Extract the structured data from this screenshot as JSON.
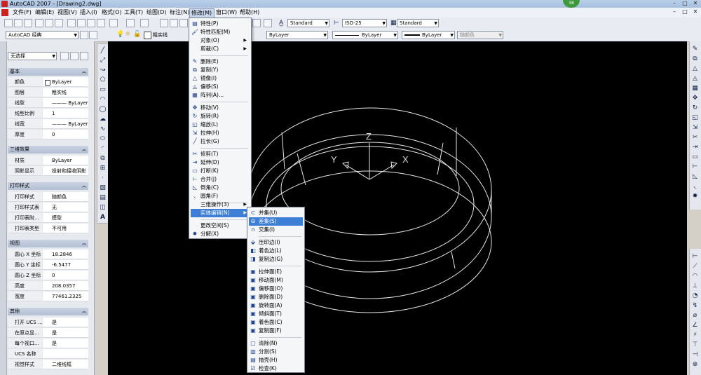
{
  "window": {
    "title": "AutoCAD 2007 - [Drawing2.dwg]",
    "badge": "38",
    "controls": [
      "–",
      "□",
      "✕"
    ]
  },
  "menubar": {
    "items": [
      {
        "label": "文件(F)"
      },
      {
        "label": "编辑(E)"
      },
      {
        "label": "视图(V)"
      },
      {
        "label": "插入(I)"
      },
      {
        "label": "格式(O)"
      },
      {
        "label": "工具(T)"
      },
      {
        "label": "绘图(D)"
      },
      {
        "label": "标注(N)"
      },
      {
        "label": "修改(M)",
        "active": true
      },
      {
        "label": "窗口(W)"
      },
      {
        "label": "帮助(H)"
      }
    ],
    "doc_controls": [
      "–",
      "□",
      "✕"
    ]
  },
  "toolbar1": {
    "text_style": "Standard",
    "dim_style": "ISO-25",
    "table_style": "Standard"
  },
  "toolbar2": {
    "workspace": "AutoCAD 经典",
    "layer": "粗实线",
    "color": "ByLayer",
    "linetype": "ByLayer",
    "lineweight": "ByLayer",
    "plotstyle": "随颜色"
  },
  "properties": {
    "selection": "无选择",
    "sections": [
      {
        "title": "基本",
        "rows": [
          {
            "label": "颜色",
            "value": "ByLayer"
          },
          {
            "label": "图层",
            "value": "粗实线"
          },
          {
            "label": "线型",
            "value": "——— ByLayer"
          },
          {
            "label": "线型比例",
            "value": "1"
          },
          {
            "label": "线宽",
            "value": "——— ByLayer"
          },
          {
            "label": "厚度",
            "value": "0"
          }
        ]
      },
      {
        "title": "三维效果",
        "rows": [
          {
            "label": "材质",
            "value": "ByLayer"
          },
          {
            "label": "阴影显示",
            "value": "投射和接收阴影"
          }
        ]
      },
      {
        "title": "打印样式",
        "rows": [
          {
            "label": "打印样式",
            "value": "随颜色"
          },
          {
            "label": "打印样式表",
            "value": "无"
          },
          {
            "label": "打印表附...",
            "value": "模型"
          },
          {
            "label": "打印表类型",
            "value": "不可用"
          }
        ]
      },
      {
        "title": "视图",
        "rows": [
          {
            "label": "圆心 X 坐标",
            "value": "18.2846"
          },
          {
            "label": "圆心 Y 坐标",
            "value": "-6.5477"
          },
          {
            "label": "圆心 Z 坐标",
            "value": "0"
          },
          {
            "label": "高度",
            "value": "208.0357"
          },
          {
            "label": "宽度",
            "value": "77461.2325"
          }
        ]
      },
      {
        "title": "其他",
        "rows": [
          {
            "label": "打开 UCS ...",
            "value": "是"
          },
          {
            "label": "在原点显...",
            "value": "是"
          },
          {
            "label": "每个视口...",
            "value": "是"
          },
          {
            "label": "UCS 名称",
            "value": ""
          },
          {
            "label": "视觉样式",
            "value": "二维线框"
          }
        ]
      }
    ]
  },
  "modify_menu": {
    "items": [
      {
        "label": "特性(P)",
        "icon": "properties-icon"
      },
      {
        "label": "特性匹配(M)",
        "icon": "match-brush-icon"
      },
      {
        "label": "对象(O)",
        "icon": "",
        "submenu": true
      },
      {
        "label": "剪裁(C)",
        "icon": "",
        "submenu": true
      },
      {
        "label": "删除(E)",
        "icon": "eraser-icon"
      },
      {
        "label": "复制(Y)",
        "icon": "copy-icon"
      },
      {
        "label": "镜像(I)",
        "icon": "mirror-icon"
      },
      {
        "label": "偏移(S)",
        "icon": "offset-icon"
      },
      {
        "label": "阵列(A)...",
        "icon": "array-icon"
      },
      {
        "label": "移动(V)",
        "icon": "move-icon"
      },
      {
        "label": "旋转(R)",
        "icon": "rotate-icon"
      },
      {
        "label": "缩放(L)",
        "icon": "scale-icon"
      },
      {
        "label": "拉伸(H)",
        "icon": "stretch-icon"
      },
      {
        "label": "拉长(G)",
        "icon": "lengthen-icon"
      },
      {
        "label": "修剪(T)",
        "icon": "trim-icon"
      },
      {
        "label": "延伸(D)",
        "icon": "extend-icon"
      },
      {
        "label": "打断(K)",
        "icon": "break-icon"
      },
      {
        "label": "合并(J)",
        "icon": "join-icon"
      },
      {
        "label": "倒角(C)",
        "icon": "chamfer-icon"
      },
      {
        "label": "圆角(F)",
        "icon": "fillet-icon"
      },
      {
        "label": "三维操作(3)",
        "icon": "",
        "submenu": true
      },
      {
        "label": "实体编辑(N)",
        "icon": "",
        "submenu": true,
        "highlight": true
      },
      {
        "label": "更改空间(S)",
        "icon": ""
      },
      {
        "label": "分解(X)",
        "icon": "explode-icon"
      }
    ]
  },
  "solid_edit_menu": {
    "items": [
      {
        "label": "并集(U)",
        "icon": "union-icon"
      },
      {
        "label": "差集(S)",
        "icon": "subtract-icon",
        "highlight": true
      },
      {
        "label": "交集(I)",
        "icon": "intersect-icon"
      },
      {
        "label": "压印边(I)",
        "icon": "imprint-icon"
      },
      {
        "label": "着色边(L)",
        "icon": "color-edge-icon"
      },
      {
        "label": "复制边(G)",
        "icon": "copy-edge-icon"
      },
      {
        "label": "拉伸面(E)",
        "icon": "extrude-face-icon"
      },
      {
        "label": "移动面(M)",
        "icon": "move-face-icon"
      },
      {
        "label": "偏移面(O)",
        "icon": "offset-face-icon"
      },
      {
        "label": "删除面(D)",
        "icon": "delete-face-icon"
      },
      {
        "label": "旋转面(A)",
        "icon": "rotate-face-icon"
      },
      {
        "label": "倾斜面(T)",
        "icon": "taper-face-icon"
      },
      {
        "label": "着色面(C)",
        "icon": "color-face-icon"
      },
      {
        "label": "复制面(F)",
        "icon": "copy-face-icon"
      },
      {
        "label": "清除(N)",
        "icon": "clean-icon"
      },
      {
        "label": "分割(S)",
        "icon": "separate-icon"
      },
      {
        "label": "抽壳(H)",
        "icon": "shell-icon"
      },
      {
        "label": "检查(K)",
        "icon": "check-icon"
      }
    ]
  },
  "ucs_icon": {
    "z_label": "Z",
    "y_label": "Y",
    "x_label": "X"
  },
  "colors": {
    "canvas": "#000000",
    "highlight": "#3d7fd6",
    "menu_bg": "#f5f6f8",
    "wireframe": "#e6e6e6"
  }
}
